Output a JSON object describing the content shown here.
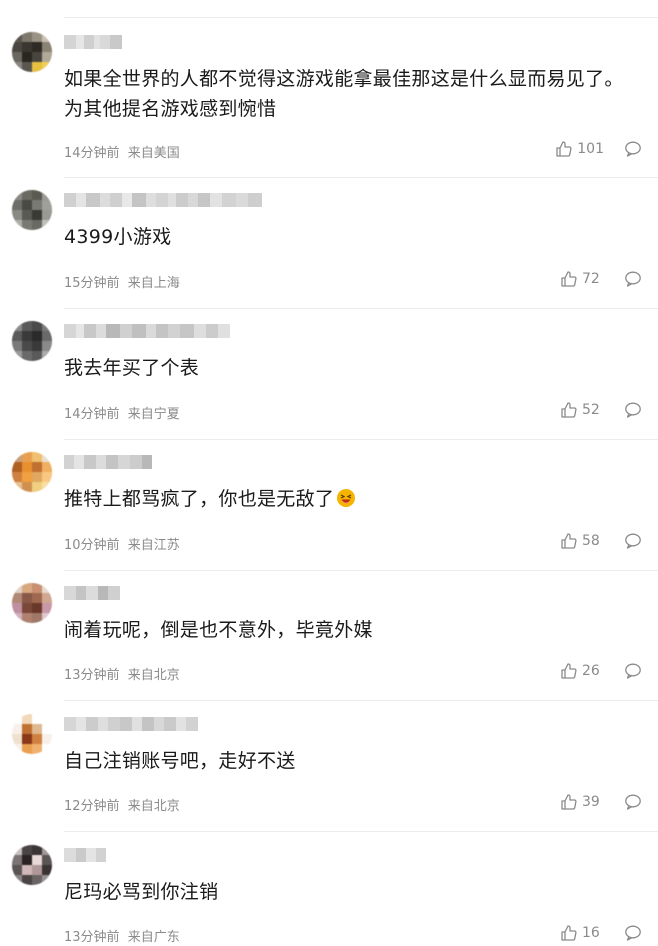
{
  "comments": [
    {
      "text": "如果全世界的人都不觉得这游戏能拿最佳那这是什么显而易见了。为其他提名游戏感到惋惜",
      "time": "14分钟前",
      "location": "来自美国",
      "likes": "101"
    },
    {
      "text": "4399小游戏",
      "time": "15分钟前",
      "location": "来自上海",
      "likes": "72"
    },
    {
      "text": "我去年买了个表",
      "time": "14分钟前",
      "location": "来自宁夏",
      "likes": "52"
    },
    {
      "text": "推特上都骂疯了，你也是无敌了",
      "time": "10分钟前",
      "location": "来自江苏",
      "likes": "58"
    },
    {
      "text": "闹着玩呢，倒是也不意外，毕竟外媒",
      "time": "13分钟前",
      "location": "来自北京",
      "likes": "26"
    },
    {
      "text": "自己注销账号吧，走好不送",
      "time": "12分钟前",
      "location": "来自北京",
      "likes": "39"
    },
    {
      "text": "尼玛必骂到你注销",
      "time": "13分钟前",
      "location": "来自广东",
      "likes": "16"
    }
  ],
  "icons": {
    "like": "thumbs-up-icon",
    "reply": "speech-bubble-icon",
    "emoji": "laughing-face-emoji"
  },
  "colors": {
    "text": "#1a1a1a",
    "meta": "#8a8a8a",
    "divider": "#ececec",
    "emoji_face": "#f5b400"
  }
}
